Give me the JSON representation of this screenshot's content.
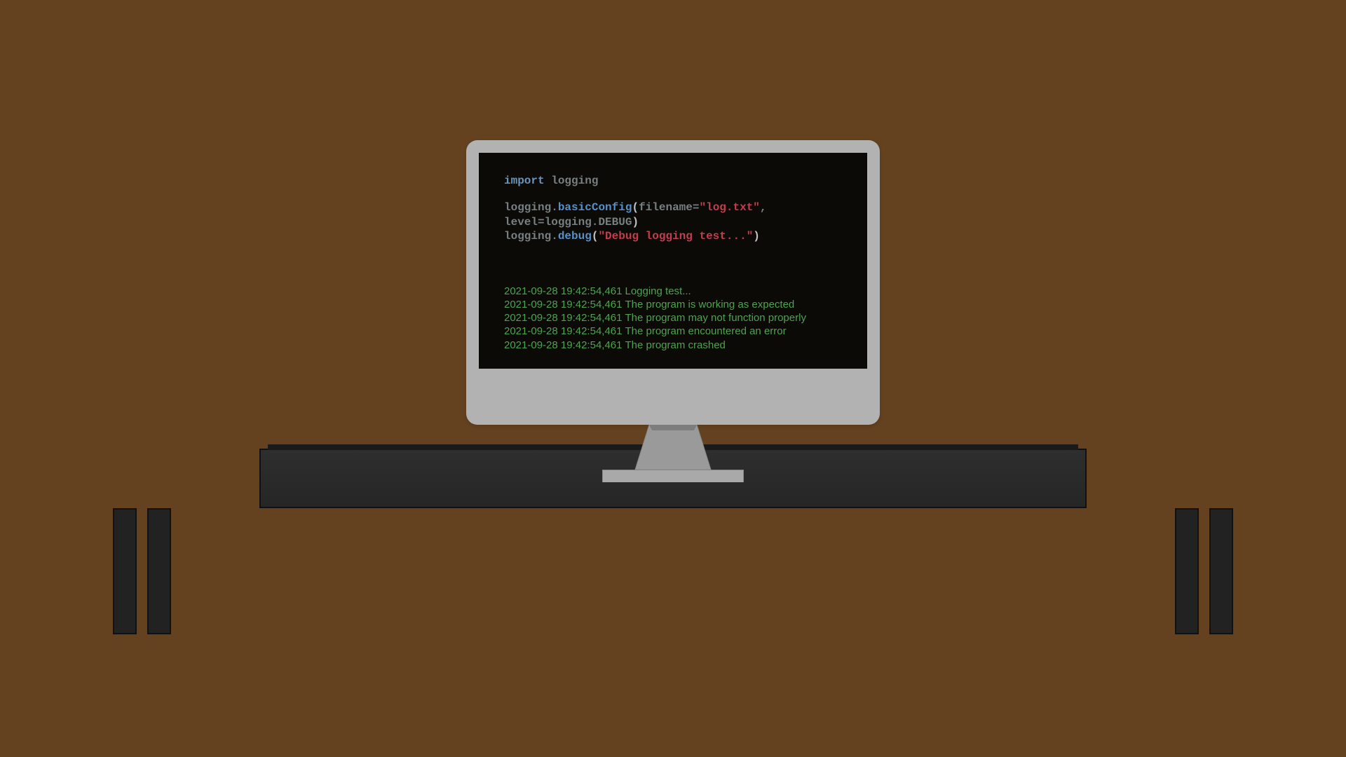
{
  "code": {
    "line1": {
      "kw": "import",
      "sp": " ",
      "mod": "logging"
    },
    "line3": {
      "obj": "logging",
      "dot": ".",
      "fn": "basicConfig",
      "po": "(",
      "arg1_name": "filename=",
      "arg1_val": "\"log.txt\"",
      "comma": ","
    },
    "line4": {
      "arg2_name": "level=",
      "arg2_obj": "logging",
      "dot": ".",
      "arg2_attr": "DEBUG",
      "pc": ")"
    },
    "line5": {
      "obj": "logging",
      "dot": ".",
      "fn": "debug",
      "po": "(",
      "str": "\"Debug logging test...\"",
      "pc": ")"
    }
  },
  "log": {
    "entries": [
      {
        "ts": "2021-09-28 19:42:54,461",
        "msg": "Logging test..."
      },
      {
        "ts": "2021-09-28 19:42:54,461",
        "msg": "The program is working as expected"
      },
      {
        "ts": "2021-09-28 19:42:54,461",
        "msg": "The program may not function properly"
      },
      {
        "ts": "2021-09-28 19:42:54,461",
        "msg": "The program encountered an error"
      },
      {
        "ts": "2021-09-28 19:42:54,461",
        "msg": "The program crashed"
      }
    ]
  }
}
